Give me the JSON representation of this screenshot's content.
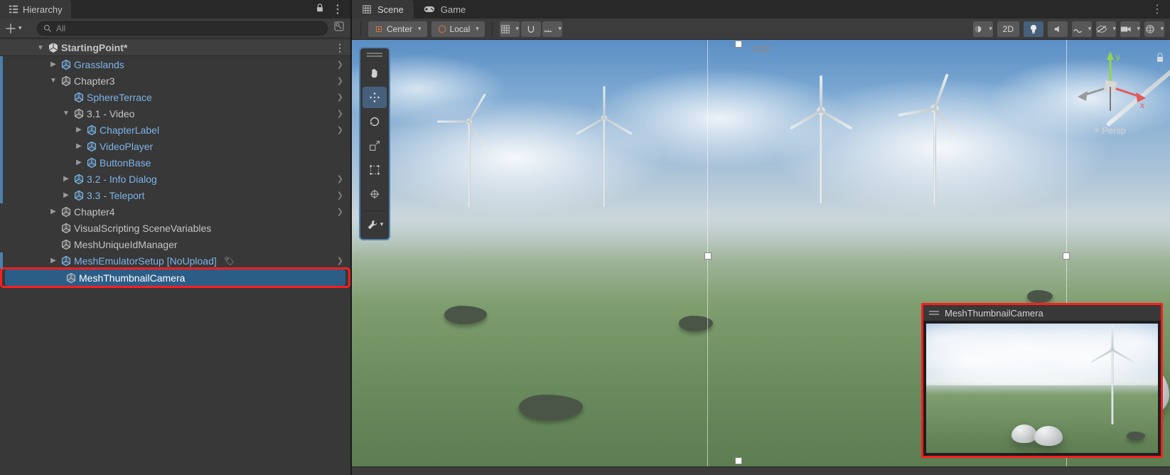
{
  "hierarchy": {
    "tab_label": "Hierarchy",
    "search_placeholder": "All",
    "scene_name": "StartingPoint*",
    "items": [
      {
        "label": "Grasslands",
        "indent": 1,
        "blue": true,
        "arrow": "right",
        "chev": true,
        "marker": true
      },
      {
        "label": "Chapter3",
        "indent": 1,
        "blue": false,
        "arrow": "down",
        "chev": true,
        "marker": true
      },
      {
        "label": "SphereTerrace",
        "indent": 2,
        "blue": true,
        "arrow": "blank",
        "chev": true,
        "marker": true
      },
      {
        "label": "3.1 - Video",
        "indent": 2,
        "blue": false,
        "arrow": "down",
        "chev": true,
        "marker": true
      },
      {
        "label": "ChapterLabel",
        "indent": 3,
        "blue": true,
        "arrow": "right",
        "chev": true,
        "marker": true
      },
      {
        "label": "VideoPlayer",
        "indent": 3,
        "blue": true,
        "arrow": "right",
        "chev": false,
        "marker": true
      },
      {
        "label": "ButtonBase",
        "indent": 3,
        "blue": true,
        "arrow": "right",
        "chev": false,
        "marker": true
      },
      {
        "label": "3.2 - Info Dialog",
        "indent": 2,
        "blue": true,
        "arrow": "right",
        "chev": true,
        "marker": true
      },
      {
        "label": "3.3 - Teleport",
        "indent": 2,
        "blue": true,
        "arrow": "right",
        "chev": true,
        "marker": true
      },
      {
        "label": "Chapter4",
        "indent": 1,
        "blue": false,
        "arrow": "right",
        "chev": true,
        "marker": false
      },
      {
        "label": "VisualScripting SceneVariables",
        "indent": 1,
        "blue": false,
        "arrow": "blank",
        "chev": false,
        "marker": false
      },
      {
        "label": "MeshUniqueIdManager",
        "indent": 1,
        "blue": false,
        "arrow": "blank",
        "chev": false,
        "marker": false
      },
      {
        "label": "MeshEmulatorSetup [NoUpload]",
        "indent": 1,
        "blue": true,
        "arrow": "right",
        "chev": true,
        "marker": true,
        "tag": true
      },
      {
        "label": "MeshThumbnailCamera",
        "indent": 1,
        "blue": false,
        "arrow": "blank",
        "chev": false,
        "marker": false,
        "selected": true,
        "highlighted": true
      }
    ]
  },
  "scene": {
    "tabs": {
      "scene": "Scene",
      "game": "Game"
    },
    "toolbar": {
      "pivot": "Center",
      "space": "Local",
      "mode2d": "2D"
    },
    "persp_label": "Persp",
    "preview_title": "MeshThumbnailCamera"
  }
}
